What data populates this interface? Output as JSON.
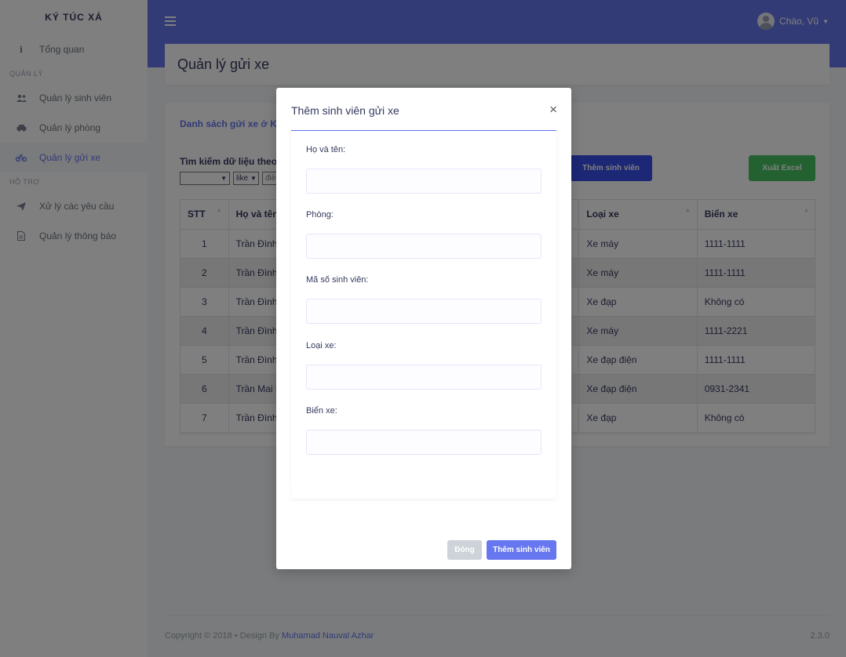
{
  "sidebar": {
    "brand": "KÝ TÚC XÁ",
    "items": [
      {
        "label": "Tổng quan",
        "icon": "info-icon"
      },
      {
        "header": "QUẢN LÝ"
      },
      {
        "label": "Quản lý sinh viên",
        "icon": "users-icon"
      },
      {
        "label": "Quản lý phòng",
        "icon": "car-icon"
      },
      {
        "label": "Quản lý gửi xe",
        "icon": "bicycle-icon",
        "active": true
      },
      {
        "header": "HỖ TRỢ"
      },
      {
        "label": "Xử lý các yêu cầu",
        "icon": "paper-plane-icon"
      },
      {
        "label": "Quản lý thông báo",
        "icon": "file-icon"
      }
    ]
  },
  "navbar": {
    "greeting": "Chào, Vũ"
  },
  "page": {
    "title": "Quản lý gửi xe"
  },
  "card": {
    "title": "Danh sách gửi xe ở Ký",
    "search_label": "Tìm kiếm dữ liệu theo",
    "search_field_value": "",
    "operator_value": "like",
    "search_input_placeholder": "điề",
    "add_button": "Thêm sinh viên",
    "excel_button": "Xuất Excel"
  },
  "table": {
    "headers": [
      "STT",
      "Họ và tên",
      "Loại xe",
      "Biển xe"
    ],
    "rows": [
      {
        "stt": "1",
        "name": "Trần Đình",
        "type": "Xe máy",
        "plate": "1111-1111"
      },
      {
        "stt": "2",
        "name": "Trần Đình",
        "type": "Xe máy",
        "plate": "1111-1111"
      },
      {
        "stt": "3",
        "name": "Trần Đình",
        "type": "Xe đạp",
        "plate": "Không có"
      },
      {
        "stt": "4",
        "name": "Trần Đình",
        "type": "Xe máy",
        "plate": "1111-2221"
      },
      {
        "stt": "5",
        "name": "Trần Đình",
        "type": "Xe đạp điện",
        "plate": "1111-1111"
      },
      {
        "stt": "6",
        "name": "Trần Mai N",
        "type": "Xe đạp điện",
        "plate": "0931-2341"
      },
      {
        "stt": "7",
        "name": "Trần Đình",
        "type": "Xe đạp",
        "plate": "Không có"
      }
    ]
  },
  "footer": {
    "copyright": "Copyright © 2018",
    "design_by": "Design By",
    "author": "Muhamad Nauval Azhar",
    "version": "2.3.0"
  },
  "modal": {
    "title": "Thêm sinh viên gửi xe",
    "close_symbol": "×",
    "fields": [
      {
        "label": "Họ và tên:",
        "value": ""
      },
      {
        "label": "Phòng:",
        "value": ""
      },
      {
        "label": "Mã số sinh viên:",
        "value": ""
      },
      {
        "label": "Loại xe:",
        "value": ""
      },
      {
        "label": "Biển xe:",
        "value": ""
      }
    ],
    "close_button": "Đóng",
    "submit_button": "Thêm sinh viên"
  },
  "colors": {
    "primary": "#6777ef",
    "success": "#47c363",
    "add_button": "#394eea"
  }
}
